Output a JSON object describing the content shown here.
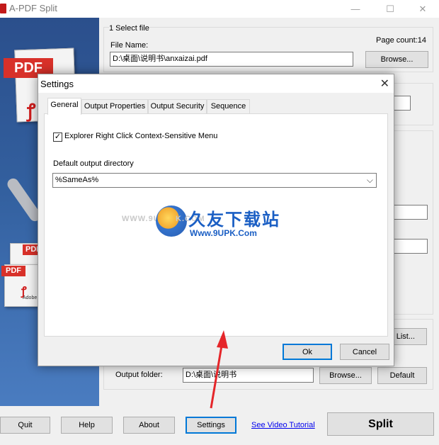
{
  "window": {
    "title": "A-PDF Split",
    "minimize": "—",
    "maximize": "☐",
    "close": "✕"
  },
  "left_panel": {
    "pdf_tags": [
      "PDF",
      "PDF",
      "PDF"
    ],
    "adobe_text": "Adobe"
  },
  "select_file": {
    "group_label": "1 Select file",
    "page_count": "Page count:14",
    "file_label": "File Name:",
    "file_value": "D:\\桌面\\说明书\\anxaizai.pdf",
    "browse_label": "Browse..."
  },
  "output": {
    "folder_label": "Output folder:",
    "folder_value": "D:\\桌面\\说明书",
    "browse_label": "Browse...",
    "default_label": "Default",
    "list_label": "List..."
  },
  "bottom": {
    "quit": "Quit",
    "help": "Help",
    "about": "About",
    "settings": "Settings",
    "video_tutorial": "See Video Tutorial",
    "split": "Split"
  },
  "dialog": {
    "title": "Settings",
    "close": "✕",
    "tabs": [
      "General",
      "Output Properties",
      "Output Security",
      "Sequence"
    ],
    "active_tab": "General",
    "checkbox_label": "Explorer Right Click Context-Sensitive Menu",
    "checkbox_checked": true,
    "checkmark": "✓",
    "dir_label": "Default output directory",
    "dir_value": "%SameAs%",
    "combo_arrow": "⌵",
    "ok": "Ok",
    "cancel": "Cancel"
  },
  "watermark": {
    "cn_text": "久友下载站",
    "url_text": "Www.9UPK.Com",
    "left_text": "WWW.9U",
    "left_text2": "K.COM"
  },
  "colors": {
    "accent": "#0078d7",
    "arrow": "#e5262a",
    "pdf_red": "#d8312a",
    "watermark_blue": "#1b5fc4"
  }
}
